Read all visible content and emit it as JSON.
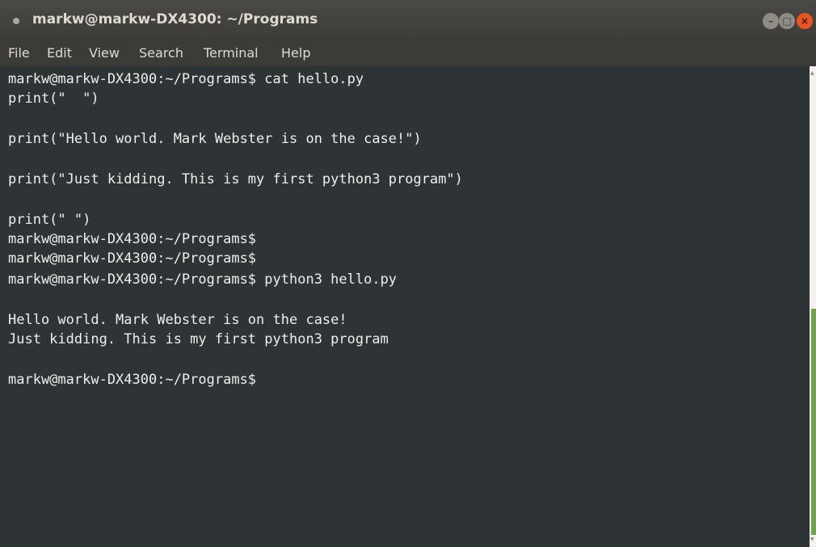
{
  "window": {
    "title": "markw@markw-DX4300: ~/Programs"
  },
  "menu": {
    "items": [
      "File",
      "Edit",
      "View",
      "Search",
      "Terminal",
      "Help"
    ]
  },
  "terminal": {
    "lines": [
      "markw@markw-DX4300:~/Programs$ cat hello.py",
      "print(\"  \")",
      "",
      "print(\"Hello world. Mark Webster is on the case!\")",
      "",
      "print(\"Just kidding. This is my first python3 program\")",
      "",
      "print(\" \")",
      "markw@markw-DX4300:~/Programs$",
      "markw@markw-DX4300:~/Programs$",
      "markw@markw-DX4300:~/Programs$ python3 hello.py",
      "",
      "Hello world. Mark Webster is on the case!",
      "Just kidding. This is my first python3 program",
      "",
      "markw@markw-DX4300:~/Programs$"
    ]
  },
  "colors": {
    "terminal_bg": "#2e3436",
    "terminal_fg": "#eeeeec",
    "close_button": "#e95420",
    "scrollbar_thumb": "#73a24e"
  },
  "icons": {
    "title": "terminal-dot-icon",
    "minimize": "minimize-icon",
    "maximize": "maximize-icon",
    "close": "close-icon"
  }
}
